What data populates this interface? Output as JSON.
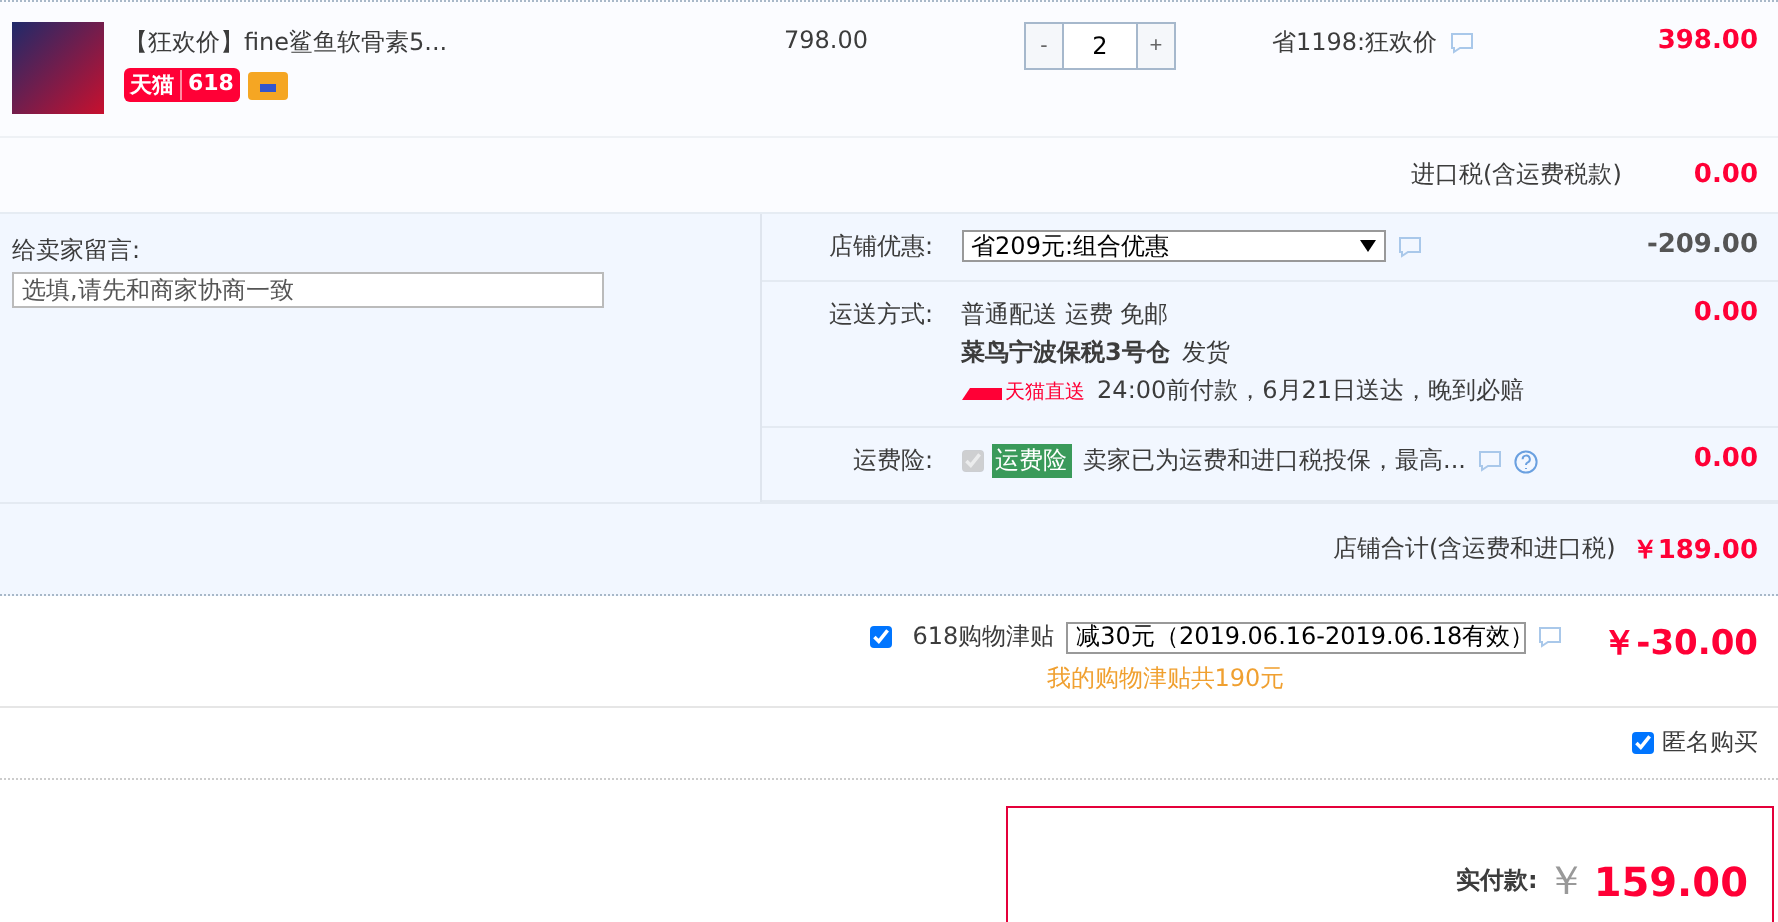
{
  "product": {
    "title": "【狂欢价】fine鲨鱼软骨素5...",
    "badge_brand": "天猫",
    "badge_event": "618",
    "unit_price": "798.00",
    "quantity": "2",
    "quantity_minus": "-",
    "quantity_plus": "+",
    "promo": "省1198:狂欢价",
    "subtotal": "398.00"
  },
  "import_tax": {
    "label": "进口税(含运费税款)",
    "value": "0.00"
  },
  "message": {
    "label": "给卖家留言:",
    "placeholder": "选填,请先和商家协商一致"
  },
  "store_discount": {
    "label": "店铺优惠:",
    "selected": "省209元:组合优惠",
    "value": "-209.00"
  },
  "shipping": {
    "label": "运送方式:",
    "method": "普通配送 运费 免邮",
    "warehouse": "菜鸟宁波保税3号仓",
    "warehouse_suffix": "发货",
    "service": "天猫直送",
    "promise": "24:00前付款，6月21日送达，晚到必赔",
    "value": "0.00"
  },
  "insurance": {
    "label": "运费险:",
    "checked": true,
    "tag": "运费险",
    "text": "卖家已为运费和进口税投保，最高...",
    "value": "0.00"
  },
  "store_total": {
    "label": "店铺合计(含运费和进口税)",
    "value": "￥189.00"
  },
  "allowance": {
    "checked": true,
    "label": "618购物津贴",
    "selected": "减30元（2019.06.16-2019.06.18有效）",
    "note": "我的购物津贴共190元",
    "value": "￥-30.00"
  },
  "anonymous": {
    "checked": true,
    "label": "匿名购买"
  },
  "payment": {
    "label": "实付款:",
    "currency": "￥",
    "amount": "159.00"
  }
}
